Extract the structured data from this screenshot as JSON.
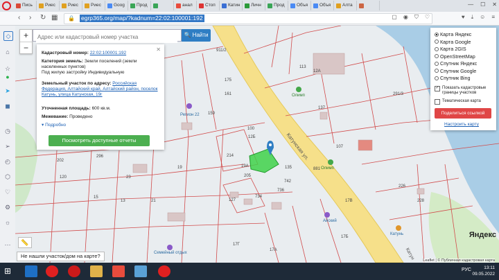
{
  "browser": {
    "tabs": [
      {
        "label": "Пись",
        "color": "#d94a38"
      },
      {
        "label": "Риес",
        "color": "#e0a020"
      },
      {
        "label": "Риес",
        "color": "#e0a020"
      },
      {
        "label": "Риес",
        "color": "#e0a020"
      },
      {
        "label": "Goog",
        "color": "#4a8af4"
      },
      {
        "label": "Прод",
        "color": "#3aa557"
      },
      {
        "label": "",
        "color": "#3aa557"
      },
      {
        "label": "анал",
        "color": "#e84c3d"
      },
      {
        "label": "Стоп",
        "color": "#d33"
      },
      {
        "label": "Катин",
        "color": "#3b6fd4"
      },
      {
        "label": "Личн",
        "color": "#2b9a3a"
      },
      {
        "label": "Прод",
        "color": "#3aa557"
      },
      {
        "label": "Объя",
        "color": "#4a8af4"
      },
      {
        "label": "Объя",
        "color": "#4a8af4"
      },
      {
        "label": "Алта",
        "color": "#e0a020"
      },
      {
        "label": "",
        "color": "#c64"
      }
    ],
    "url": "egrp365.org/map/?kadnum=22:02:100001:192"
  },
  "search": {
    "placeholder": "Адрес или кадастровый номер участка",
    "button": "Найти"
  },
  "info": {
    "cad_label": "Кадастровый номер:",
    "cad_value": "22:02:100001:192",
    "category_label": "Категория земель:",
    "category_value": "Земли поселений (земли населенных пунктов)",
    "usage": "Под жилую застройку Индивидуальную",
    "address_label": "Земельный участок по адресу:",
    "address_value": "Российская Федерация, Алтайский край, Алтайский район, поселок Катунь, улица Катунская, 19г",
    "area_label": "Уточненная площадь:",
    "area_value": "600 кв.м.",
    "survey_label": "Межевание:",
    "survey_value": "Проведено",
    "more": "Подробно",
    "report_button": "Посмотреть доступные отчеты"
  },
  "layers": {
    "options": [
      {
        "label": "Карта Яндекс",
        "selected": true
      },
      {
        "label": "Карта Google",
        "selected": false
      },
      {
        "label": "Карта 2GIS",
        "selected": false
      },
      {
        "label": "OpenStreetMap",
        "selected": false
      },
      {
        "label": "Спутник Яндекс",
        "selected": false
      },
      {
        "label": "Спутник Google",
        "selected": false
      },
      {
        "label": "Спутник Bing",
        "selected": false
      }
    ],
    "show_cadastral": "Показать кадастровые границы участков",
    "show_cadastral_checked": true,
    "thematic": "Тематическая карта",
    "thematic_checked": false,
    "share": "Поделиться ссылкой",
    "setup": "Настроить карту"
  },
  "map": {
    "not_found": "Не нашли участок/дом на карте?",
    "yandex": "Яндекс",
    "attribution": "Leaflet | © Публичная кадастровая карта",
    "street": "Катунская ул.",
    "street2": "Катун",
    "pois": [
      "Олимп",
      "Катунь",
      "Айский",
      "Семейный отдых",
      "Регион 22",
      "Олимп"
    ],
    "parcel_numbers": [
      "113",
      "12А",
      "137",
      "911/2",
      "291/3",
      "175",
      "161",
      "159",
      "100",
      "12Б",
      "214",
      "19А",
      "135",
      "205",
      "107",
      "226",
      "228",
      "296",
      "202",
      "19",
      "734",
      "736",
      "742",
      "127",
      "17Б",
      "17В",
      "17А",
      "17Г",
      "13",
      "15",
      "21",
      "23",
      "120",
      "881"
    ]
  },
  "taskbar": {
    "lang": "РУС",
    "time": "13:11",
    "date": "09.05.2022"
  }
}
